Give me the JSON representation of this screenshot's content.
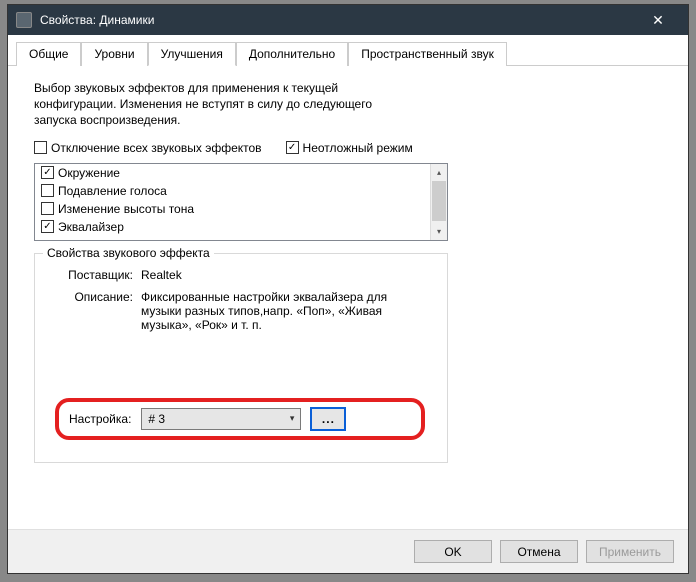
{
  "window": {
    "title": "Свойства: Динамики"
  },
  "tabs": {
    "general": "Общие",
    "levels": "Уровни",
    "enhancements": "Улучшения",
    "advanced": "Дополнительно",
    "spatial": "Пространственный звук"
  },
  "panel": {
    "description": "Выбор звуковых эффектов для применения к текущей конфигурации. Изменения не вступят в силу до следующего запуска воспроизведения.",
    "disable_all": "Отключение всех звуковых эффектов",
    "urgent_mode": "Неотложный режим",
    "effects": [
      {
        "label": "Окружение",
        "checked": true
      },
      {
        "label": "Подавление голоса",
        "checked": false
      },
      {
        "label": "Изменение высоты тона",
        "checked": false
      },
      {
        "label": "Эквалайзер",
        "checked": true
      }
    ],
    "groupbox_title": "Свойства звукового эффекта",
    "vendor_label": "Поставщик:",
    "vendor_value": "Realtek",
    "desc_label": "Описание:",
    "desc_value": "Фиксированные настройки эквалайзера для музыки разных типов,напр. «Поп», «Живая музыка», «Рок» и т. п.",
    "setting_label": "Настройка:",
    "setting_value": "# 3",
    "more_button": "..."
  },
  "buttons": {
    "ok": "OK",
    "cancel": "Отмена",
    "apply": "Применить"
  }
}
